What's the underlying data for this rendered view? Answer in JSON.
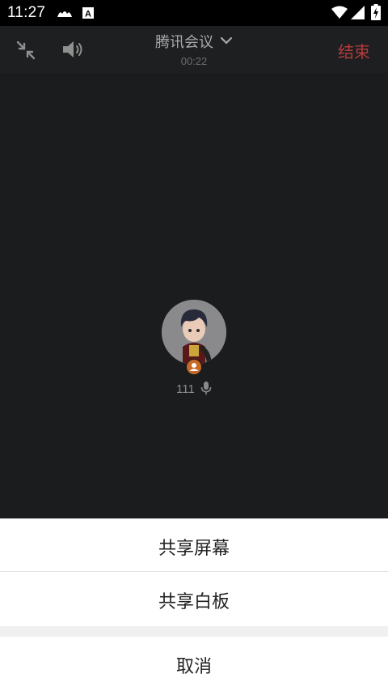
{
  "status_bar": {
    "time": "11:27",
    "icons": [
      "cloud-notification-icon",
      "a-notification-icon",
      "wifi-icon",
      "signal-icon",
      "battery-charging-icon"
    ]
  },
  "call_header": {
    "title": "腾讯会议",
    "duration": "00:22",
    "end_label": "结束",
    "end_color": "#b43b3b"
  },
  "participant": {
    "name": "111"
  },
  "share_sheet": {
    "items": [
      {
        "label": "共享屏幕"
      },
      {
        "label": "共享白板"
      }
    ],
    "cancel_label": "取消"
  }
}
